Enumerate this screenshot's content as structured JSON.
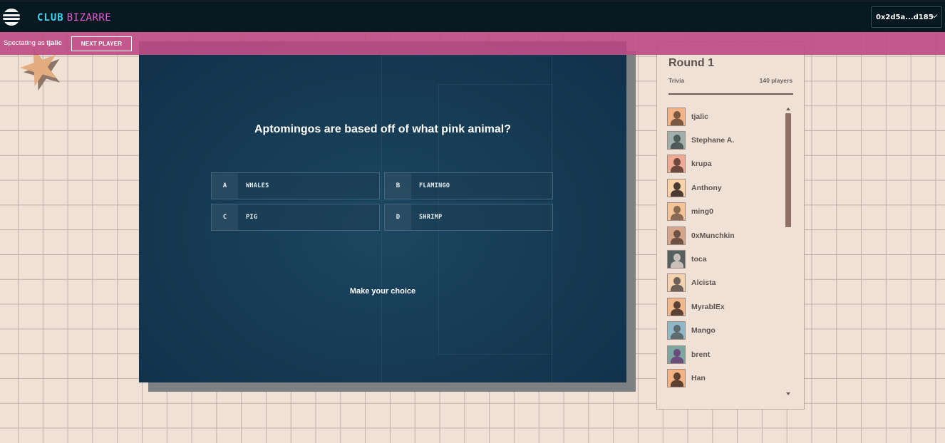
{
  "header": {
    "menu_icon": "hamburger-circle-icon",
    "brand_club": "CLUB",
    "brand_bizarre": "BIZARRE",
    "wallet_address": "0x2d5a...d185",
    "wallet_chevron_icon": "chevron-down-icon"
  },
  "spectate_bar": {
    "prefix": "Spectating as",
    "username": "tjalic",
    "next_player_label": "NEXT PLAYER"
  },
  "game": {
    "question": "Aptomingos are based off of what pink animal?",
    "answers": [
      {
        "letter": "A",
        "text": "WHALES"
      },
      {
        "letter": "B",
        "text": "FLAMINGO"
      },
      {
        "letter": "C",
        "text": "PIG"
      },
      {
        "letter": "D",
        "text": "SHRIMP"
      }
    ],
    "prompt": "Make your choice"
  },
  "panel": {
    "round_title": "Round 1",
    "game_type": "Trivia",
    "player_count": "140 players",
    "players": [
      {
        "name": "tjalic",
        "bg": "#f2b487",
        "fg": "#7b5840"
      },
      {
        "name": "Stephane A.",
        "bg": "#9fb1aa",
        "fg": "#4e5b59"
      },
      {
        "name": "krupa",
        "bg": "#f0a993",
        "fg": "#6e4a3e"
      },
      {
        "name": "Anthony",
        "bg": "#f7d3a6",
        "fg": "#4a3b33"
      },
      {
        "name": "ming0",
        "bg": "#f5c496",
        "fg": "#8a6a54"
      },
      {
        "name": "0xMunchkin",
        "bg": "#d6a68a",
        "fg": "#6e5246"
      },
      {
        "name": "toca",
        "bg": "#55605f",
        "fg": "#c9c1b9"
      },
      {
        "name": "Alcista",
        "bg": "#f3d2ad",
        "fg": "#6d6058"
      },
      {
        "name": "MyrablEx",
        "bg": "#f1b889",
        "fg": "#5a4336"
      },
      {
        "name": "Mango",
        "bg": "#8fb8c8",
        "fg": "#5e6a6e"
      },
      {
        "name": "brent",
        "bg": "#7ca7a0",
        "fg": "#6b4c7a"
      },
      {
        "name": "Han",
        "bg": "#f2b282",
        "fg": "#5c4030"
      }
    ],
    "scroll_up_icon": "scroll-up-arrow-icon",
    "scroll_down_icon": "scroll-down-arrow-icon"
  },
  "colors": {
    "topbar_bg": "#061820",
    "spectate_bar_bg": "#be4e85",
    "game_bg": "#173c55",
    "page_bg": "#efe1d6",
    "brand_club": "#35d7f5",
    "brand_bizarre": "#ea5ad2"
  }
}
